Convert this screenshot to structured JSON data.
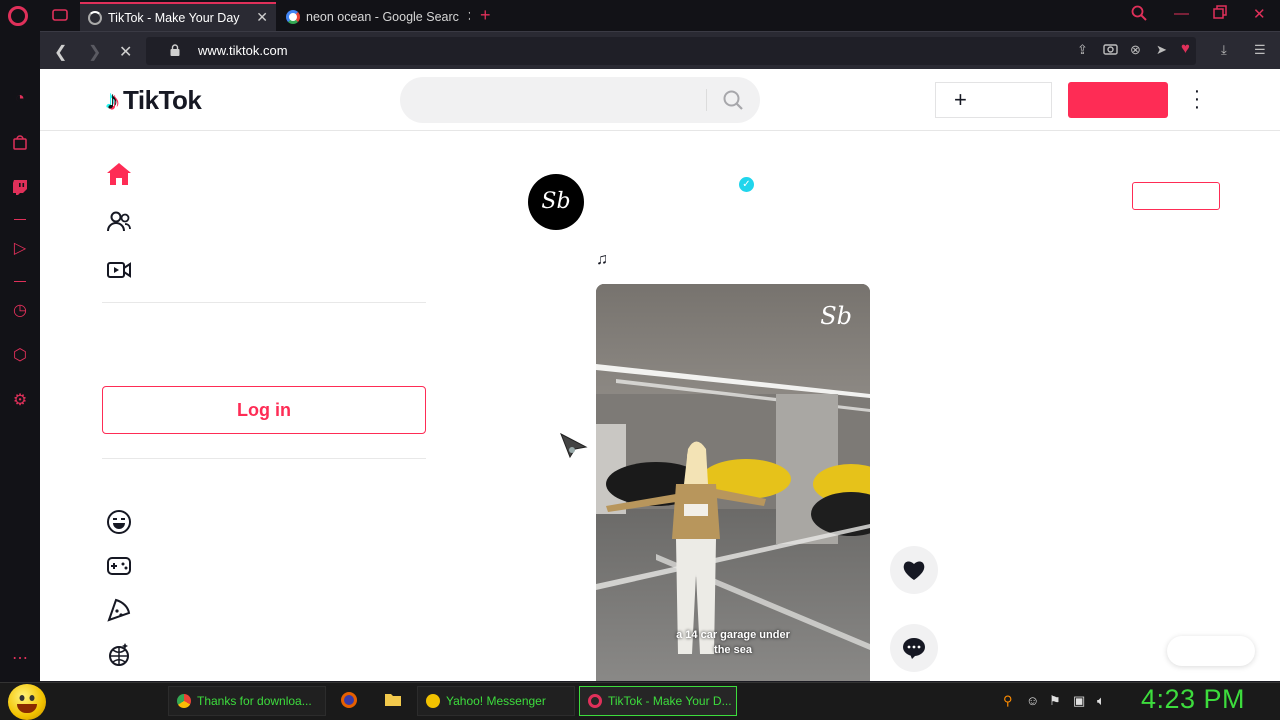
{
  "browser": {
    "tabs": [
      {
        "title": "TikTok - Make Your Day",
        "active": true
      },
      {
        "title": "neon ocean - Google Searc",
        "active": false
      }
    ],
    "url": "www.tiktok.com",
    "accent_color": "#e0305a",
    "sidebar_icons": [
      "speed-dial-icon",
      "shopping-bag-icon",
      "twitch-icon",
      "player-icon",
      "history-icon",
      "box-icon",
      "settings-icon",
      "more-icon"
    ]
  },
  "tiktok": {
    "logo_text": "TikTok",
    "search_placeholder": "",
    "upload_label": "",
    "header_login_label": "",
    "login_button_label": "Log in",
    "brand_color": "#fe2c55",
    "nav_icons": [
      "home-icon",
      "following-icon",
      "live-icon"
    ],
    "discover_icons": [
      "comedy-icon",
      "gaming-icon",
      "food-icon",
      "dance-icon"
    ],
    "post": {
      "avatar_text": "Sb",
      "watermark": "Sb",
      "caption_line1": "a 14 car garage under",
      "caption_line2": "the sea"
    }
  },
  "taskbar": {
    "items": [
      {
        "label": "Thanks for downloa...",
        "icon": "chrome-icon",
        "active": false
      },
      {
        "label": "Yahoo! Messenger",
        "icon": "yahoo-messenger-icon",
        "active": false
      },
      {
        "label": "TikTok - Make Your D...",
        "icon": "opera-icon",
        "active": true
      }
    ],
    "clock": "4:23 PM",
    "text_color": "#3ddc3d"
  }
}
